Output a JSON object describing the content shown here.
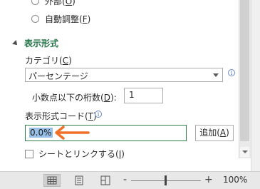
{
  "options": {
    "outside": {
      "text": "外部(",
      "key": "O",
      "tail": ")"
    },
    "auto_adjust": {
      "text": "自動調整(",
      "key": "F",
      "tail": ")"
    }
  },
  "section": {
    "title": "表示形式"
  },
  "category": {
    "label": {
      "text": "カテゴリ(",
      "key": "C",
      "tail": ")"
    },
    "selected": "パーセンテージ"
  },
  "decimal_places": {
    "label": {
      "text": "小数点以下の桁数(",
      "key": "D",
      "tail": "):"
    },
    "value": "1"
  },
  "format_code": {
    "label": {
      "text": "表示形式コード(",
      "key": "T",
      "tail": ")"
    },
    "value": "0.0%"
  },
  "add_button": {
    "text": "追加(",
    "key": "A",
    "tail": ")"
  },
  "link_to_source": {
    "text": "シートとリンクする(",
    "key": "I",
    "tail": ")"
  },
  "info_glyph": "i",
  "status": {
    "zoom_minus": "-",
    "zoom_plus": "+",
    "zoom": "100%",
    "zoom_fraction": 0.5
  },
  "colors": {
    "accent": "#217346",
    "arrow": "#f0702a",
    "selection": "#99c1e8"
  }
}
